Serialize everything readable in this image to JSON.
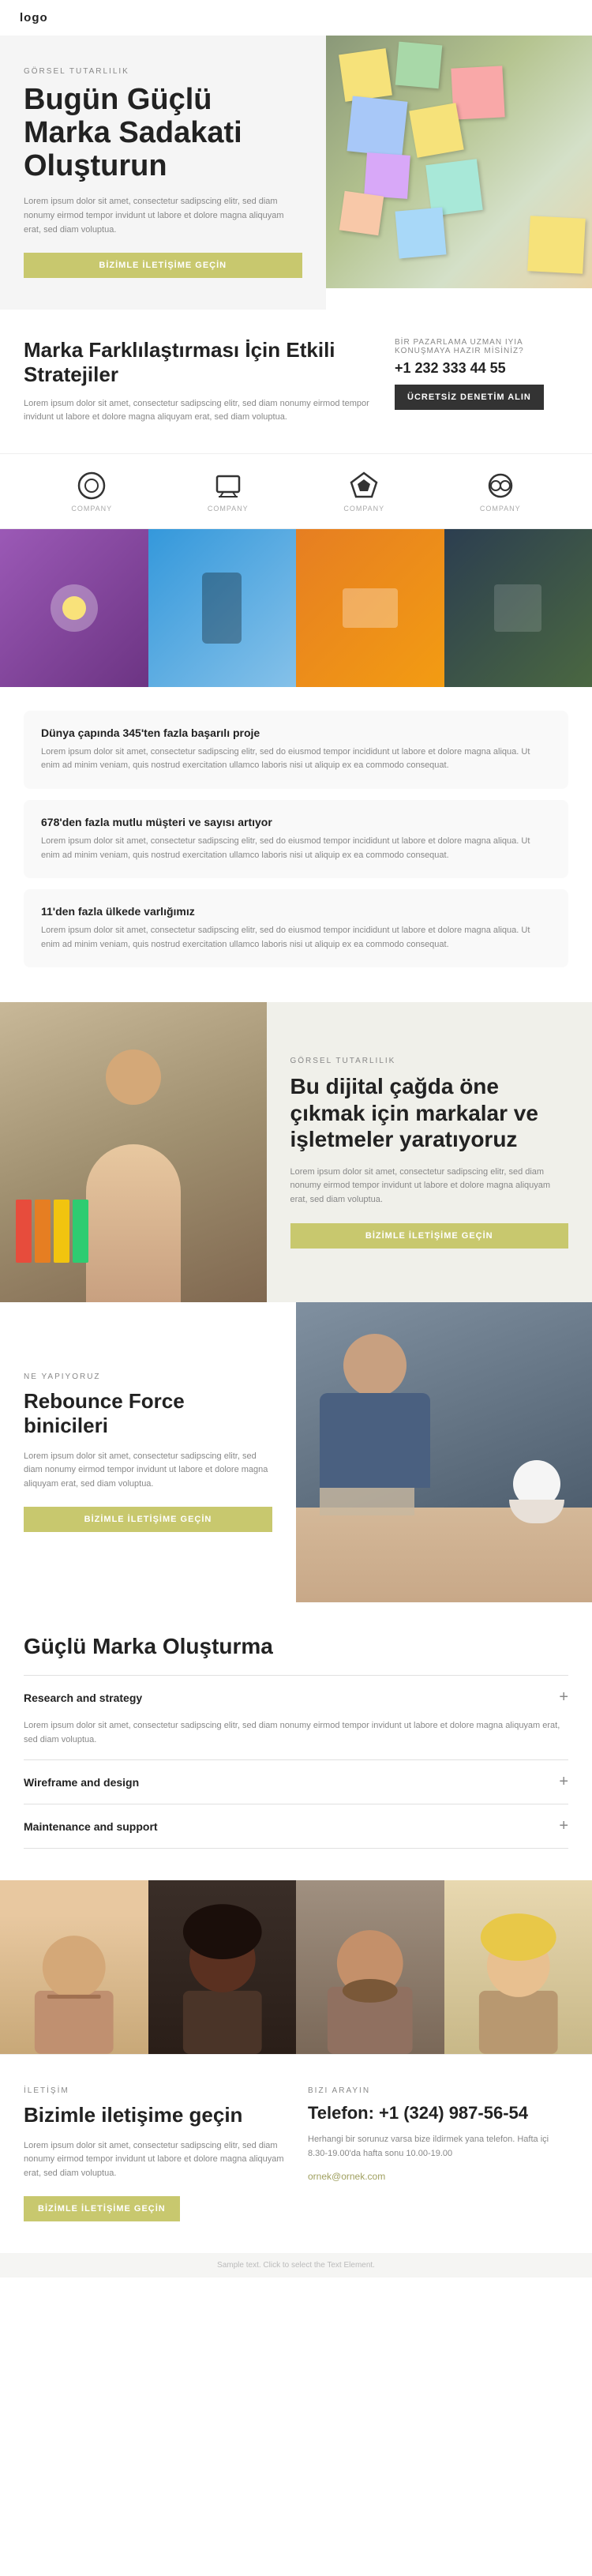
{
  "nav": {
    "logo": "logo",
    "hamburger_label": "menu"
  },
  "hero": {
    "label": "GÖRSEL TUTARLILIK",
    "title": "Bugün Güçlü Marka Sadakati Oluşturun",
    "text": "Lorem ipsum dolor sit amet, consectetur sadipscing elitr, sed diam nonumy eirmod tempor invidunt ut labore et dolore magna aliquyam erat, sed diam voluptua.",
    "cta": "BİZİMLE İLETİŞİME GEÇİN"
  },
  "brand_section": {
    "title": "Marka Farklılaştırması İçin Etkili Stratejiler",
    "text": "Lorem ipsum dolor sit amet, consectetur sadipscing elitr, sed diam nonumy eirmod tempor invidunt ut labore et dolore magna aliquyam erat, sed diam voluptua.",
    "right_label": "BİR PAZARLAMA UZMAN IYIA KONUŞMAYA HAZIR MİSİNİZ?",
    "phone": "+1 232 333 44 55",
    "cta": "ÜCRETSİZ DENETİM ALIN"
  },
  "logos": [
    {
      "label": "COMPANY"
    },
    {
      "label": "COMPANY"
    },
    {
      "label": "COMPANY"
    },
    {
      "label": "COMPANY"
    }
  ],
  "stats": [
    {
      "title": "Dünya çapında 345'ten fazla başarılı proje",
      "text": "Lorem ipsum dolor sit amet, consectetur sadipscing elitr, sed do eiusmod tempor incididunt ut labore et dolore magna aliqua. Ut enim ad minim veniam, quis nostrud exercitation ullamco laboris nisi ut aliquip ex ea commodo consequat."
    },
    {
      "title": "678'den fazla mutlu müşteri ve sayısı artıyor",
      "text": "Lorem ipsum dolor sit amet, consectetur sadipscing elitr, sed do eiusmod tempor incididunt ut labore et dolore magna aliqua. Ut enim ad minim veniam, quis nostrud exercitation ullamco laboris nisi ut aliquip ex ea commodo consequat."
    },
    {
      "title": "11'den fazla ülkede varlığımız",
      "text": "Lorem ipsum dolor sit amet, consectetur sadipscing elitr, sed do eiusmod tempor incididunt ut labore et dolore magna aliqua. Ut enim ad minim veniam, quis nostrud exercitation ullamco laboris nisi ut aliquip ex ea commodo consequat."
    }
  ],
  "digital": {
    "label": "GÖRSEL TUTARLILIK",
    "title": "Bu dijital çağda öne çıkmak için markalar ve işletmeler yaratıyoruz",
    "text": "Lorem ipsum dolor sit amet, consectetur sadipscing elitr, sed diam nonumy eirmod tempor invidunt ut labore et dolore magna aliquyam erat, sed diam voluptua.",
    "cta": "BİZİMLE İLETİŞİME GEÇİN"
  },
  "rebounce": {
    "label": "NE YAPIYORUZ",
    "title": "Rebounce Force binicileri",
    "text": "Lorem ipsum dolor sit amet, consectetur sadipscing elitr, sed diam nonumy eirmod tempor invidunt ut labore et dolore magna aliquyam erat, sed diam voluptua.",
    "cta": "BİZİMLE İLETİŞİME GEÇİN"
  },
  "brand_building": {
    "title": "Güçlü Marka Oluşturma",
    "accordion": [
      {
        "title": "Research and strategy",
        "text": "Lorem ipsum dolor sit amet, consectetur sadipscing elitr, sed diam nonumy eirmod tempor invidunt ut labore et dolore magna aliquyam erat, sed diam voluptua.",
        "open": true
      },
      {
        "title": "Wireframe and design",
        "text": "",
        "open": false
      },
      {
        "title": "Maintenance and support",
        "text": "",
        "open": false
      }
    ]
  },
  "contact": {
    "label": "İLETİŞİM",
    "title": "Bizimle iletişime geçin",
    "text": "Lorem ipsum dolor sit amet, consectetur sadipscing elitr, sed diam nonumy eirmod tempor invidunt ut labore et dolore magna aliquyam erat, sed diam voluptua.",
    "cta": "BİZİMLE İLETİŞİME GEÇİN",
    "right_label": "BIZI ARAYIN",
    "phone": "Telefon: +1 (324) 987-56-54",
    "desc": "Herhangi bir sorunuz varsa bize ildirmek yana telefon. Hafta içi 8.30-19.00'da hafta sonu 10.00-19.00",
    "email": "ornek@ornek.com"
  },
  "footer": {
    "text": "Sample text. Click to select the Text Element."
  }
}
